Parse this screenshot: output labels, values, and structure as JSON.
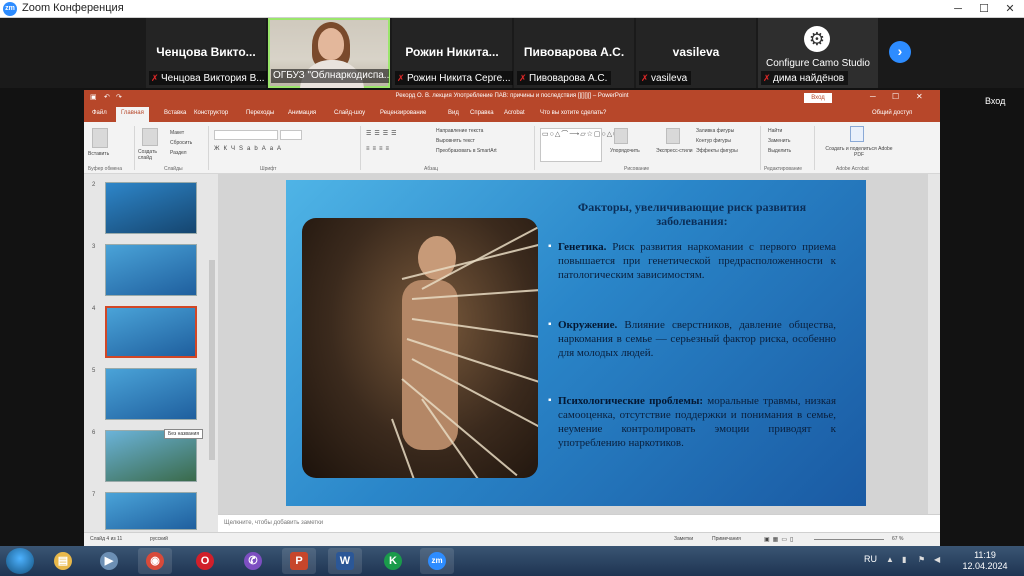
{
  "zoom": {
    "title": "Zoom Конференция",
    "exit_label": "Вход",
    "participants": [
      {
        "name": "Ченцова Викто...",
        "label": "Ченцова Виктория В..."
      },
      {
        "name": "",
        "label": "ОГБУЗ \"Облнаркодиспа..."
      },
      {
        "name": "Рожин Никита...",
        "label": "Рожин Никита Серге..."
      },
      {
        "name": "Пивоварова А.С.",
        "label": "Пивоварова А.С."
      },
      {
        "name": "vasileva",
        "label": "vasileva"
      },
      {
        "name": "Configure Camo Studio",
        "label": "дима найдёнов"
      }
    ],
    "next_icon": "chevron-right-icon"
  },
  "ppt": {
    "title": "Рекорд О. В. лекция Употребление ПАВ: причины и последствия [][][][] – PowerPoint",
    "login": "Вход",
    "share": "Общий доступ",
    "tabs": [
      "Файл",
      "Главная",
      "Вставка",
      "Конструктор",
      "Переходы",
      "Анимация",
      "Слайд-шоу",
      "Рецензирование",
      "Вид",
      "Справка",
      "Acrobat",
      "Что вы хотите сделать?"
    ],
    "active_tab": "Главная",
    "ribbon": {
      "groups": [
        "Буфер обмена",
        "Слайды",
        "Шрифт",
        "Абзац",
        "Рисование",
        "Редактирование",
        "Adobe Acrobat"
      ],
      "buttons": {
        "paste": "Вставить",
        "new_slide": "Создать слайд",
        "layout": "Макет",
        "reset": "Сбросить",
        "section": "Раздел",
        "text_direction": "Направление текста",
        "align_text": "Выровнять текст",
        "smartart": "Преобразовать в SmartArt",
        "arrange": "Упорядочить",
        "quick_styles": "Экспресс-стили",
        "shape_fill": "Заливка фигуры",
        "shape_outline": "Контур фигуры",
        "shape_effects": "Эффекты фигуры",
        "find": "Найти",
        "replace": "Заменить",
        "select": "Выделить",
        "acrobat": "Создать и поделиться Adobe PDF"
      }
    },
    "thumbnails": [
      {
        "num": "2"
      },
      {
        "num": "3"
      },
      {
        "num": "4"
      },
      {
        "num": "5"
      },
      {
        "num": "6"
      },
      {
        "num": "7"
      }
    ],
    "tooltip": "Без названия",
    "selected_thumb": 4,
    "slide": {
      "heading": "Факторы, увеличивающие риск развития заболевания:",
      "bullets": [
        {
          "bold": "Генетика.",
          "text": " Риск развития наркомании с первого приема повышается при генетической предрасположенности к патологическим зависимостям."
        },
        {
          "bold": "Окружение.",
          "text": " Влияние сверстников, давление общества, наркомания в семье — серьезный фактор риска, особенно для молодых людей."
        },
        {
          "bold": "Психологические проблемы:",
          "text": " моральные травмы, низкая самооценка, отсутствие поддержки и понимания в семье, неумение контролировать эмоции приводят к употреблению наркотиков."
        }
      ]
    },
    "notes_placeholder": "Щелкните, чтобы добавить заметки",
    "status": {
      "slide": "Слайд 4 из 11",
      "lang": "русский",
      "notes": "Заметки",
      "comments": "Примечания",
      "zoom": "67 %"
    }
  },
  "taskbar": {
    "apps": [
      {
        "name": "explorer",
        "glyph": "▤",
        "color": "#e8b84a"
      },
      {
        "name": "media",
        "glyph": "▶",
        "color": "#6c8fb4"
      },
      {
        "name": "chrome",
        "glyph": "◉",
        "color": "#d84a3a"
      },
      {
        "name": "opera",
        "glyph": "O",
        "color": "#d11f2a"
      },
      {
        "name": "viber",
        "glyph": "✆",
        "color": "#7d4fc1"
      },
      {
        "name": "powerpoint",
        "glyph": "P",
        "color": "#c7462b"
      },
      {
        "name": "word",
        "glyph": "W",
        "color": "#2b5797"
      },
      {
        "name": "kaspersky",
        "glyph": "K",
        "color": "#1a9b4b"
      },
      {
        "name": "zoom",
        "glyph": "zm",
        "color": "#2d8cff"
      }
    ],
    "lang": "RU",
    "time": "11:19",
    "date": "12.04.2024"
  }
}
